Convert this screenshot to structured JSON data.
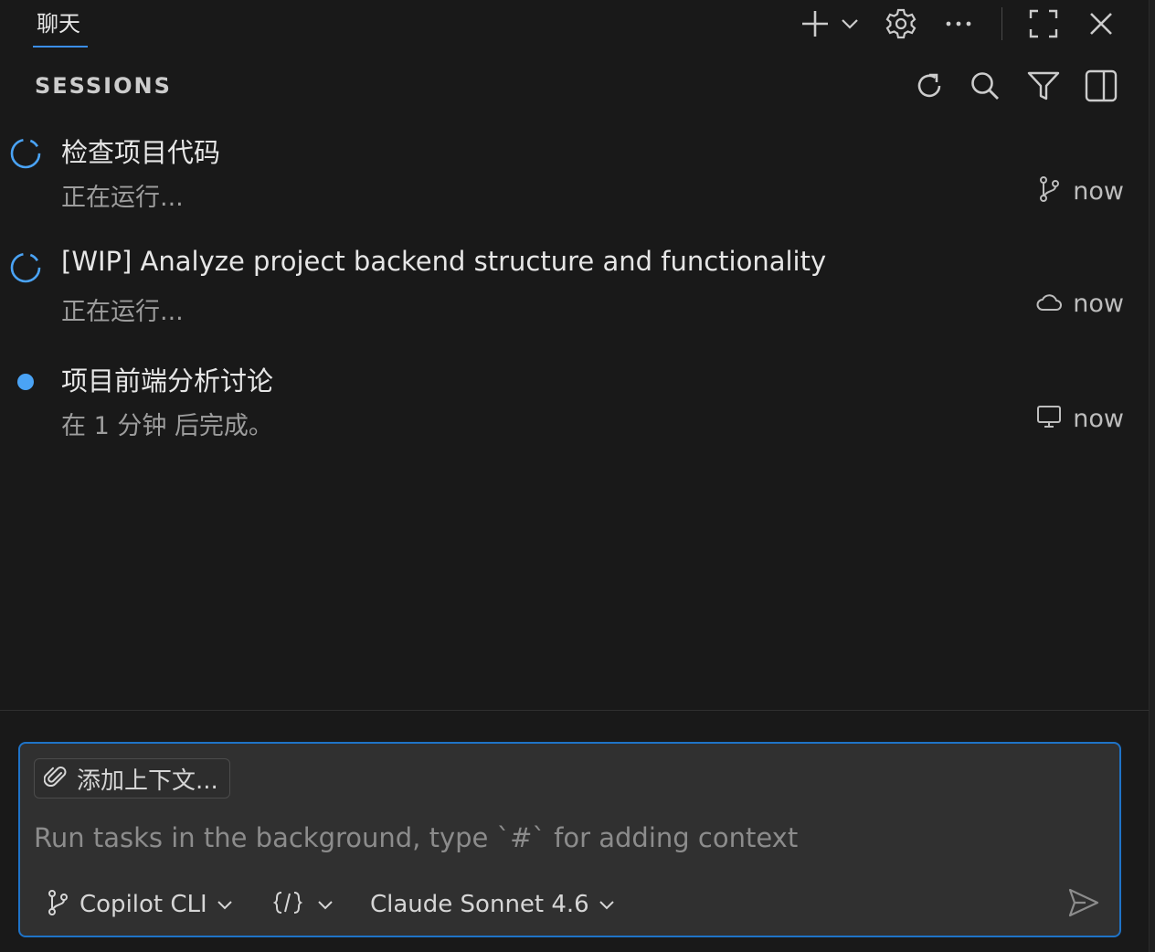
{
  "titlebar": {
    "tab_label": "聊天",
    "icons": [
      "plus-icon",
      "chevron-down-icon",
      "gear-icon",
      "ellipsis-icon",
      "maximize-icon",
      "close-icon"
    ]
  },
  "sessions": {
    "header": "SESSIONS",
    "header_icons": [
      "refresh-icon",
      "search-icon",
      "filter-icon",
      "split-panel-icon"
    ],
    "items": [
      {
        "title": "检查项目代码",
        "subtitle": "正在运行...",
        "status": "running",
        "location_icon": "git-branch-icon",
        "time": "now"
      },
      {
        "title": "[WIP] Analyze project backend structure and functionality",
        "subtitle": "正在运行...",
        "status": "running",
        "location_icon": "cloud-icon",
        "time": "now"
      },
      {
        "title": "项目前端分析讨论",
        "subtitle": "在 1 分钟 后完成。",
        "status": "completed-unread",
        "location_icon": "monitor-icon",
        "time": "now"
      }
    ]
  },
  "input": {
    "add_context_label": "添加上下文...",
    "placeholder": "Run tasks in the background, type `#` for adding context",
    "agent_label": "Copilot CLI",
    "mode_icon": "code-brackets-icon",
    "model_label": "Claude Sonnet 4.6"
  },
  "colors": {
    "background": "#191919",
    "accent": "#1f73c7",
    "status_dot": "#4aa3f5",
    "spinner": "#4aa3f5"
  }
}
